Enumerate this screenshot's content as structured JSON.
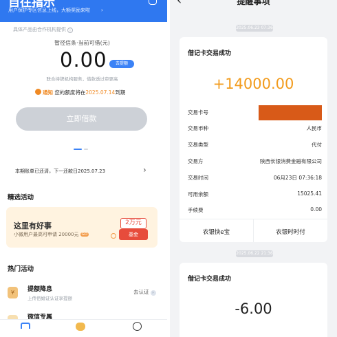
{
  "left": {
    "header": {
      "title": "自往指示",
      "subtitle": "用户保护专区信息上线，大额奖励来啦",
      "arrow": "›"
    },
    "credit": {
      "provider": "具体产品由合作机构提供",
      "provider_info": "i",
      "limit_label": "暂径信条·当前可借(元)",
      "amount": "0.00",
      "raise_button": "去提额",
      "service_note": "联合持牌机构服务，借款透过审更高",
      "notice_tag": "通知",
      "notice_text": "您的额度将在",
      "notice_date": "2025.07.14",
      "notice_suffix": "到期",
      "borrow_button": "立即借款"
    },
    "bill": {
      "text": "本期账单已还清，下一还款日2025.07.23",
      "chevron": "›"
    },
    "featured": {
      "heading": "精选活动",
      "promo_title": "这里有好事",
      "promo_sub": "小微用户最高可申请 20000元",
      "promo_go": "GO",
      "coupon": "2万元",
      "fund": "基金"
    },
    "hot": {
      "heading": "热门活动",
      "item_title": "提额降息",
      "item_desc": "上传佰婚证认证享提额",
      "item_action": "去认证",
      "item_action_arrow": "›",
      "item_icon": "¥",
      "item2_title": "微信专属"
    }
  },
  "right": {
    "header": {
      "back": "‹",
      "title": "提醒事项",
      "more": "···"
    },
    "timestamp1": "2025.06.23 07:36",
    "txn1": {
      "title": "借记卡交易成功",
      "amount": "+14000.00",
      "rows": [
        {
          "label": "交易卡号",
          "value": ""
        },
        {
          "label": "交易币种",
          "value": "人民币"
        },
        {
          "label": "交易类型",
          "value": "代付"
        },
        {
          "label": "交易方",
          "value": "陕西长银消费金融有限公司"
        },
        {
          "label": "交易时间",
          "value": "06月23日 07:36:18"
        },
        {
          "label": "可用余额",
          "value": "15025.41"
        },
        {
          "label": "手续费",
          "value": "0.00"
        }
      ],
      "button_left": "农银快e宝",
      "button_right": "农银时时付"
    },
    "timestamp2": "2025.06.22 21:36",
    "txn2": {
      "title": "借记卡交易成功",
      "amount": "-6.00"
    }
  },
  "colors": {
    "brand_blue": "#2f78f0",
    "accent_orange": "#f29b1c",
    "mask_orange": "#d85a18"
  }
}
